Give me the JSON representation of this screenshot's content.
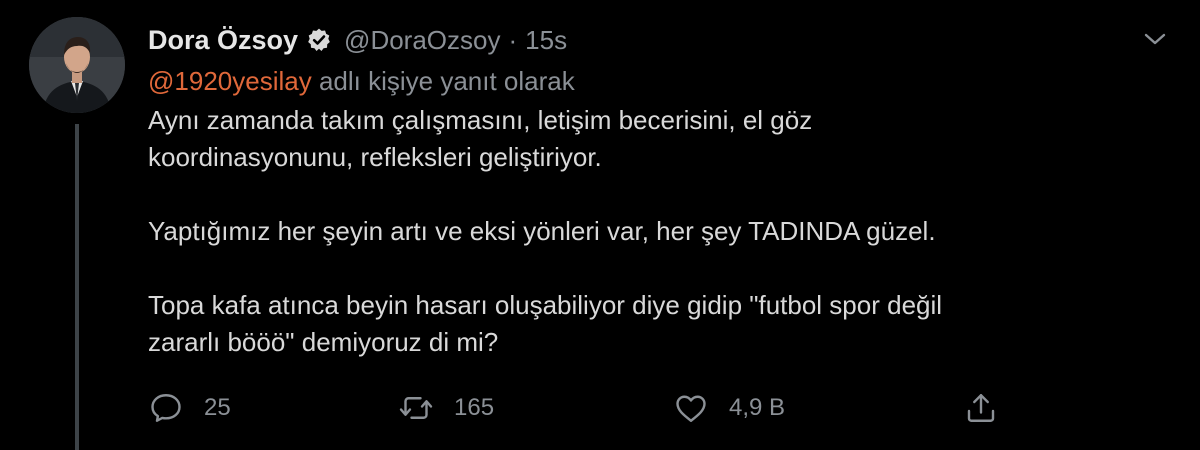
{
  "tweet": {
    "author": {
      "display_name": "Dora Özsoy",
      "verified_icon": "verified-badge-icon",
      "handle": "@DoraOzsoy",
      "separator": "·",
      "timestamp": "15s"
    },
    "reply_to": {
      "mention": "@1920yesilay",
      "suffix": "adlı kişiye yanıt olarak"
    },
    "paragraphs": [
      "Aynı zamanda takım çalışmasını, letişim becerisini, el göz\nkoordinasyonunu, refleksleri geliştiriyor.",
      "Yaptığımız her şeyin artı ve eksi yönleri var, her şey TADINDA güzel.",
      "Topa kafa atınca beyin hasarı oluşabiliyor diye gidip \"futbol spor değil\nzararlı bööö\" demiyoruz di mi?"
    ],
    "actions": {
      "reply": {
        "icon": "reply-icon",
        "count": "25"
      },
      "retweet": {
        "icon": "retweet-icon",
        "count": "165"
      },
      "like": {
        "icon": "heart-icon",
        "count": "4,9 B"
      },
      "share": {
        "icon": "share-icon"
      }
    },
    "menu_icon": "chevron-down-icon"
  },
  "colors": {
    "background": "#000000",
    "text": "#d9d9d9",
    "muted": "#8b9096",
    "mention": "#e0683a",
    "thread_line": "#3d4348"
  }
}
